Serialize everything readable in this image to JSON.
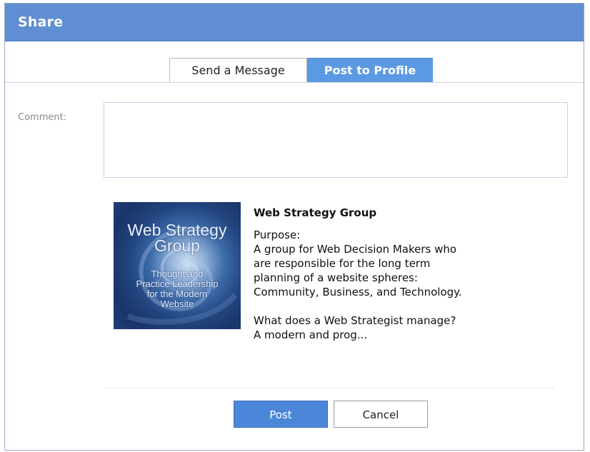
{
  "dialog": {
    "title": "Share"
  },
  "tabs": [
    {
      "label": "Send a Message",
      "active": false
    },
    {
      "label": "Post to Profile",
      "active": true
    }
  ],
  "comment": {
    "label": "Comment:",
    "value": ""
  },
  "attachment": {
    "thumbnail": {
      "title_line1": "Web Strategy",
      "title_line2": "Group",
      "sub_line1": "Thought and",
      "sub_line2": "Practice Leadership",
      "sub_line3": "for the Modern",
      "sub_line4": "Website"
    },
    "title": "Web Strategy Group",
    "description": "Purpose:\nA group for Web Decision Makers who\nare responsible for the long term\nplanning of a website spheres:\nCommunity, Business, and Technology.\n\nWhat does a Web Strategist manage?\nA modern and prog..."
  },
  "buttons": {
    "post": "Post",
    "cancel": "Cancel"
  },
  "colors": {
    "titlebar": "#5f8ed2",
    "active_tab": "#5b9ae2",
    "primary_button": "#4c86d8"
  }
}
